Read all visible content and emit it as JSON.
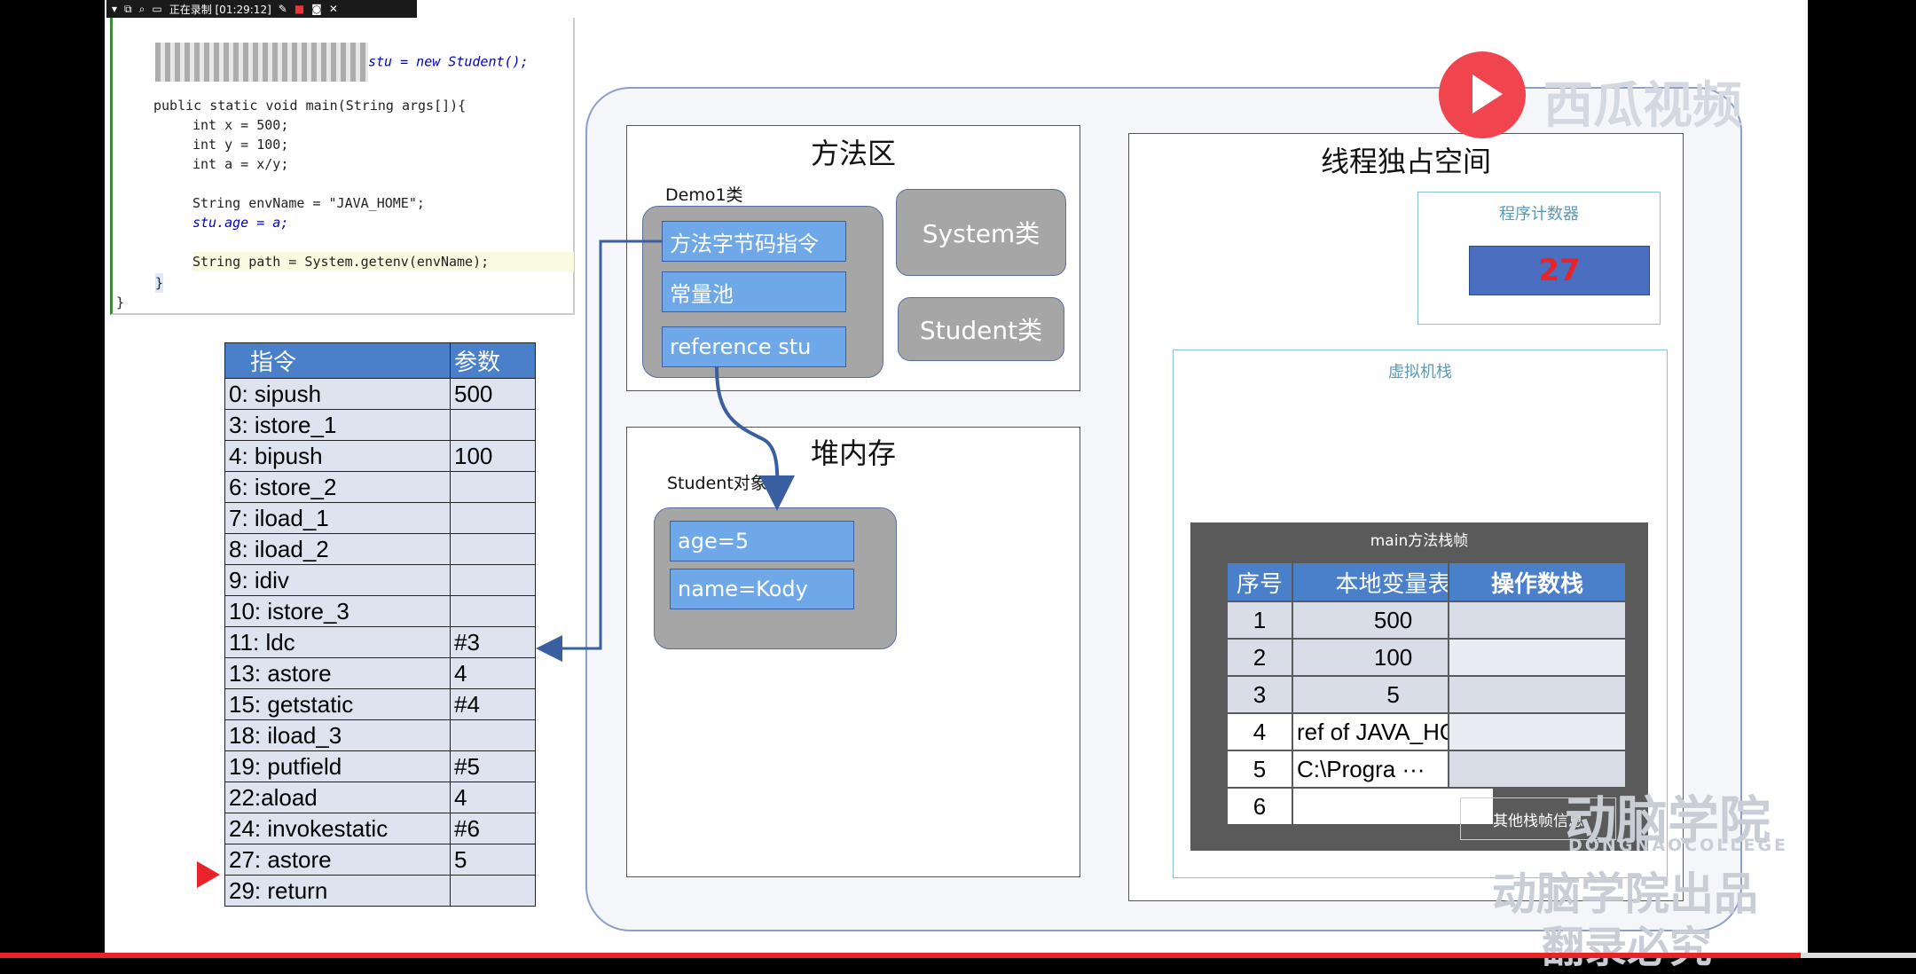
{
  "recorder": {
    "status": "正在录制 [01:29:12]"
  },
  "code": {
    "line_field": "stu = new Student();",
    "line_main": "public static void main(String args[]){",
    "line_x": "int x = 500;",
    "line_y": "int y = 100;",
    "line_a": "int a = x/y;",
    "line_env": "String envName = \"JAVA_HOME\";",
    "line_age": "stu.age = a;",
    "line_path": "String path = System.getenv(envName);",
    "line_close1": "}",
    "line_close2": "}"
  },
  "instructions": {
    "headers": [
      "指令",
      "参数"
    ],
    "rows": [
      [
        "0: sipush",
        "500"
      ],
      [
        "3: istore_1",
        ""
      ],
      [
        "4: bipush",
        "100"
      ],
      [
        "6: istore_2",
        ""
      ],
      [
        "7: iload_1",
        ""
      ],
      [
        "8: iload_2",
        ""
      ],
      [
        "9: idiv",
        ""
      ],
      [
        "10: istore_3",
        ""
      ],
      [
        "11: ldc",
        "#3"
      ],
      [
        "13: astore",
        "4"
      ],
      [
        "15: getstatic",
        "#4"
      ],
      [
        "18: iload_3",
        ""
      ],
      [
        "19: putfield",
        "#5"
      ],
      [
        "22:aload",
        "4"
      ],
      [
        "24: invokestatic",
        "#6"
      ],
      [
        "27: astore",
        "5"
      ],
      [
        "29: return",
        ""
      ]
    ],
    "current_index": 15
  },
  "method_area": {
    "title": "方法区",
    "class_label": "Demo1类",
    "items": [
      "方法字节码指令",
      "常量池",
      "reference stu"
    ],
    "system_class": "System类",
    "student_class": "Student类"
  },
  "heap": {
    "title": "堆内存",
    "object_label": "Student对象",
    "fields": [
      "age=5",
      "name=Kody"
    ]
  },
  "thread_space": {
    "title": "线程独占空间",
    "pc_label": "程序计数器",
    "pc_value": "27",
    "vm_stack_label": "虚拟机栈",
    "frame_label": "main方法栈帧",
    "locals_headers": [
      "序号",
      "本地变量表"
    ],
    "locals": [
      [
        "1",
        "500"
      ],
      [
        "2",
        "100"
      ],
      [
        "3",
        "5"
      ],
      [
        "4",
        "ref  of JAVA_HOME"
      ],
      [
        "5",
        "C:\\Progra ···"
      ],
      [
        "6",
        ""
      ]
    ],
    "operand_header": "操作数栈",
    "other_info": "其他栈帧信息"
  },
  "watermarks": {
    "xigua": "西瓜视频",
    "dongnao": "动脑学院",
    "dongnao_en": "DONGNAOCOLLEGE",
    "produced": "动脑学院出品",
    "copyright": "翻录必究"
  },
  "colors": {
    "accent": "#4a7fc9",
    "pc_value": "#e8232a",
    "pointer": "#e8232a"
  }
}
